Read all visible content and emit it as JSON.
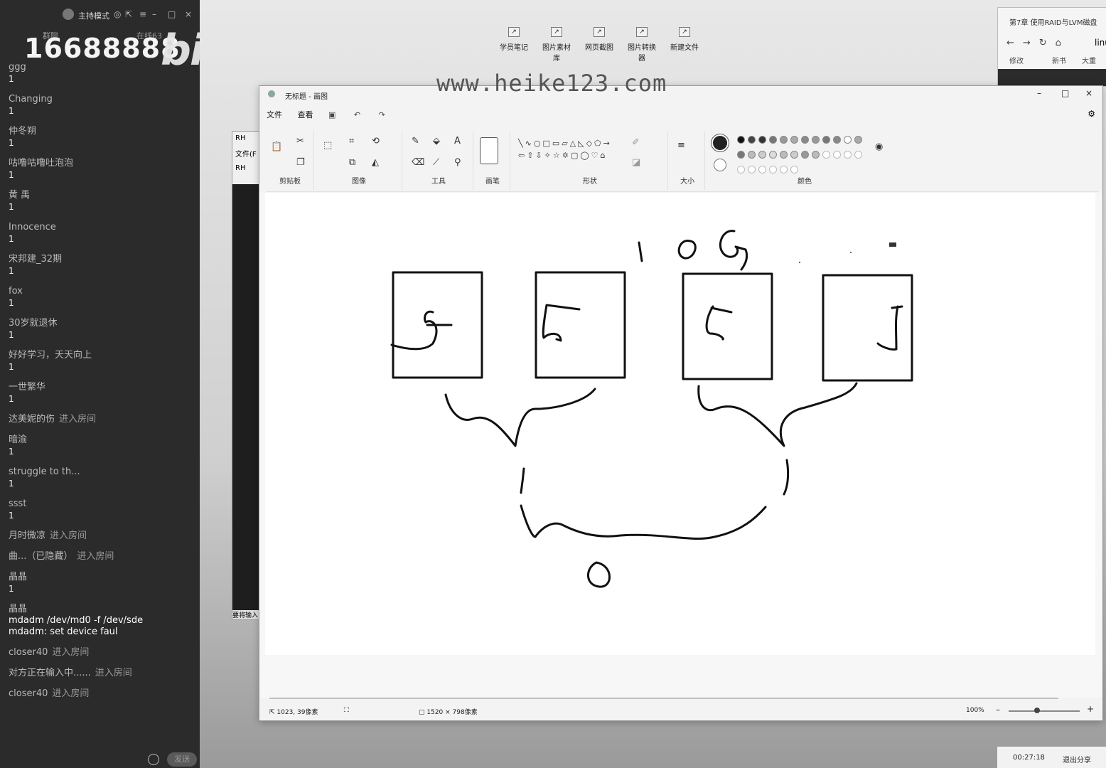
{
  "chat": {
    "mode_label": "主持模式",
    "sub_left": "群聊",
    "sub_right": "在线63",
    "room_number": "16688888",
    "brand": "bilibili",
    "messages": [
      {
        "name": "ggg",
        "text": "1"
      },
      {
        "name": "Changing",
        "text": "1"
      },
      {
        "name": "仲冬朔",
        "text": "1"
      },
      {
        "name": "咕噜咕噜吐泡泡",
        "text": "1"
      },
      {
        "name": "黄 禹",
        "text": "1"
      },
      {
        "name": "Innocence",
        "text": "1"
      },
      {
        "name": "宋邦建_32期",
        "text": "1"
      },
      {
        "name": "fox",
        "text": "1"
      },
      {
        "name": "30岁就退休",
        "text": "1"
      },
      {
        "name": "好好学习，天天向上",
        "text": "1"
      },
      {
        "name": "一世繁华",
        "text": "1"
      }
    ],
    "event_1": {
      "name": "达美妮的伤",
      "action": "进入房间"
    },
    "messages2": [
      {
        "name": "暗渝",
        "text": "1"
      },
      {
        "name": "struggle to th...",
        "text": "1"
      },
      {
        "name": "ssst",
        "text": "1"
      }
    ],
    "event_2": {
      "name": "月时微凉",
      "action": "进入房间"
    },
    "event_3": {
      "name": "曲...（已隐藏）",
      "action": "进入房间"
    },
    "msg_jj": {
      "name": "晶晶",
      "text": "1"
    },
    "msg_cmd": {
      "name": "晶晶",
      "line1": "mdadm /dev/md0 -f /dev/sde",
      "line2": "mdadm: set device faul"
    },
    "event_4": {
      "name": "closer40",
      "action": "进入房间"
    },
    "event_5": {
      "name": "对方正在输入中......",
      "action": "进入房间"
    },
    "event_6": {
      "name": "closer40",
      "action": "进入房间"
    },
    "send_label": "发送"
  },
  "desktop": {
    "watermark": "www.heike123.com",
    "icons": [
      "学员笔记",
      "图片素材库",
      "网页截图",
      "图片转换器",
      "新建文件"
    ]
  },
  "background_window": {
    "title": "RH",
    "menu": "文件(F",
    "tab": "RH",
    "footer": "要将输入"
  },
  "browser": {
    "tab_title": "第7章 使用RAID与LVM磁盘",
    "url_fragment": "linu",
    "bookmark_1": "修改",
    "bookmark_2": "新书",
    "bookmark_3": "大重"
  },
  "stream_status": {
    "elapsed": "00:27:18",
    "exit_label": "退出分享"
  },
  "paint": {
    "title": "无标题 - 画图",
    "menu": [
      "文件",
      "查看"
    ],
    "groups": {
      "clipboard": "剪贴板",
      "image": "图像",
      "tools": "工具",
      "brushes": "画笔",
      "shapes": "形状",
      "size": "大小",
      "colors": "颜色"
    },
    "shapes_glyphs": "╲∿○□▭▱△◺◇⬠→⇦⇧⇩✧☆✡▢◯♡⌂",
    "status": {
      "cursor_pos": "1023, 39像素",
      "canvas_size": "1520 × 798像素",
      "zoom": "100%"
    },
    "drawing_labels": {
      "total": "10G",
      "digit_1": "5",
      "digit_2": "5",
      "digit_3": "5",
      "digit_4": "5",
      "result": "0"
    }
  },
  "colors": {
    "chat_bg": "#2b2b2b",
    "paint_bg": "#f3f3f3",
    "ink": "#111111"
  }
}
